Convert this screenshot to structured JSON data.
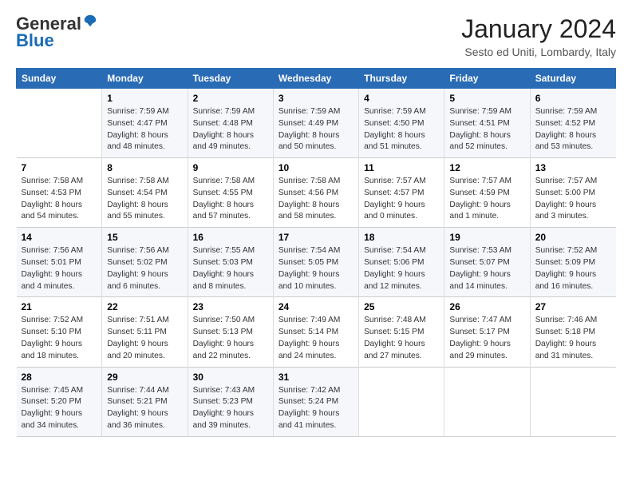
{
  "header": {
    "logo_general": "General",
    "logo_blue": "Blue",
    "month": "January 2024",
    "location": "Sesto ed Uniti, Lombardy, Italy"
  },
  "weekdays": [
    "Sunday",
    "Monday",
    "Tuesday",
    "Wednesday",
    "Thursday",
    "Friday",
    "Saturday"
  ],
  "rows": [
    [
      {
        "day": "",
        "lines": []
      },
      {
        "day": "1",
        "lines": [
          "Sunrise: 7:59 AM",
          "Sunset: 4:47 PM",
          "Daylight: 8 hours",
          "and 48 minutes."
        ]
      },
      {
        "day": "2",
        "lines": [
          "Sunrise: 7:59 AM",
          "Sunset: 4:48 PM",
          "Daylight: 8 hours",
          "and 49 minutes."
        ]
      },
      {
        "day": "3",
        "lines": [
          "Sunrise: 7:59 AM",
          "Sunset: 4:49 PM",
          "Daylight: 8 hours",
          "and 50 minutes."
        ]
      },
      {
        "day": "4",
        "lines": [
          "Sunrise: 7:59 AM",
          "Sunset: 4:50 PM",
          "Daylight: 8 hours",
          "and 51 minutes."
        ]
      },
      {
        "day": "5",
        "lines": [
          "Sunrise: 7:59 AM",
          "Sunset: 4:51 PM",
          "Daylight: 8 hours",
          "and 52 minutes."
        ]
      },
      {
        "day": "6",
        "lines": [
          "Sunrise: 7:59 AM",
          "Sunset: 4:52 PM",
          "Daylight: 8 hours",
          "and 53 minutes."
        ]
      }
    ],
    [
      {
        "day": "7",
        "lines": [
          "Sunrise: 7:58 AM",
          "Sunset: 4:53 PM",
          "Daylight: 8 hours",
          "and 54 minutes."
        ]
      },
      {
        "day": "8",
        "lines": [
          "Sunrise: 7:58 AM",
          "Sunset: 4:54 PM",
          "Daylight: 8 hours",
          "and 55 minutes."
        ]
      },
      {
        "day": "9",
        "lines": [
          "Sunrise: 7:58 AM",
          "Sunset: 4:55 PM",
          "Daylight: 8 hours",
          "and 57 minutes."
        ]
      },
      {
        "day": "10",
        "lines": [
          "Sunrise: 7:58 AM",
          "Sunset: 4:56 PM",
          "Daylight: 8 hours",
          "and 58 minutes."
        ]
      },
      {
        "day": "11",
        "lines": [
          "Sunrise: 7:57 AM",
          "Sunset: 4:57 PM",
          "Daylight: 9 hours",
          "and 0 minutes."
        ]
      },
      {
        "day": "12",
        "lines": [
          "Sunrise: 7:57 AM",
          "Sunset: 4:59 PM",
          "Daylight: 9 hours",
          "and 1 minute."
        ]
      },
      {
        "day": "13",
        "lines": [
          "Sunrise: 7:57 AM",
          "Sunset: 5:00 PM",
          "Daylight: 9 hours",
          "and 3 minutes."
        ]
      }
    ],
    [
      {
        "day": "14",
        "lines": [
          "Sunrise: 7:56 AM",
          "Sunset: 5:01 PM",
          "Daylight: 9 hours",
          "and 4 minutes."
        ]
      },
      {
        "day": "15",
        "lines": [
          "Sunrise: 7:56 AM",
          "Sunset: 5:02 PM",
          "Daylight: 9 hours",
          "and 6 minutes."
        ]
      },
      {
        "day": "16",
        "lines": [
          "Sunrise: 7:55 AM",
          "Sunset: 5:03 PM",
          "Daylight: 9 hours",
          "and 8 minutes."
        ]
      },
      {
        "day": "17",
        "lines": [
          "Sunrise: 7:54 AM",
          "Sunset: 5:05 PM",
          "Daylight: 9 hours",
          "and 10 minutes."
        ]
      },
      {
        "day": "18",
        "lines": [
          "Sunrise: 7:54 AM",
          "Sunset: 5:06 PM",
          "Daylight: 9 hours",
          "and 12 minutes."
        ]
      },
      {
        "day": "19",
        "lines": [
          "Sunrise: 7:53 AM",
          "Sunset: 5:07 PM",
          "Daylight: 9 hours",
          "and 14 minutes."
        ]
      },
      {
        "day": "20",
        "lines": [
          "Sunrise: 7:52 AM",
          "Sunset: 5:09 PM",
          "Daylight: 9 hours",
          "and 16 minutes."
        ]
      }
    ],
    [
      {
        "day": "21",
        "lines": [
          "Sunrise: 7:52 AM",
          "Sunset: 5:10 PM",
          "Daylight: 9 hours",
          "and 18 minutes."
        ]
      },
      {
        "day": "22",
        "lines": [
          "Sunrise: 7:51 AM",
          "Sunset: 5:11 PM",
          "Daylight: 9 hours",
          "and 20 minutes."
        ]
      },
      {
        "day": "23",
        "lines": [
          "Sunrise: 7:50 AM",
          "Sunset: 5:13 PM",
          "Daylight: 9 hours",
          "and 22 minutes."
        ]
      },
      {
        "day": "24",
        "lines": [
          "Sunrise: 7:49 AM",
          "Sunset: 5:14 PM",
          "Daylight: 9 hours",
          "and 24 minutes."
        ]
      },
      {
        "day": "25",
        "lines": [
          "Sunrise: 7:48 AM",
          "Sunset: 5:15 PM",
          "Daylight: 9 hours",
          "and 27 minutes."
        ]
      },
      {
        "day": "26",
        "lines": [
          "Sunrise: 7:47 AM",
          "Sunset: 5:17 PM",
          "Daylight: 9 hours",
          "and 29 minutes."
        ]
      },
      {
        "day": "27",
        "lines": [
          "Sunrise: 7:46 AM",
          "Sunset: 5:18 PM",
          "Daylight: 9 hours",
          "and 31 minutes."
        ]
      }
    ],
    [
      {
        "day": "28",
        "lines": [
          "Sunrise: 7:45 AM",
          "Sunset: 5:20 PM",
          "Daylight: 9 hours",
          "and 34 minutes."
        ]
      },
      {
        "day": "29",
        "lines": [
          "Sunrise: 7:44 AM",
          "Sunset: 5:21 PM",
          "Daylight: 9 hours",
          "and 36 minutes."
        ]
      },
      {
        "day": "30",
        "lines": [
          "Sunrise: 7:43 AM",
          "Sunset: 5:23 PM",
          "Daylight: 9 hours",
          "and 39 minutes."
        ]
      },
      {
        "day": "31",
        "lines": [
          "Sunrise: 7:42 AM",
          "Sunset: 5:24 PM",
          "Daylight: 9 hours",
          "and 41 minutes."
        ]
      },
      {
        "day": "",
        "lines": []
      },
      {
        "day": "",
        "lines": []
      },
      {
        "day": "",
        "lines": []
      }
    ]
  ]
}
